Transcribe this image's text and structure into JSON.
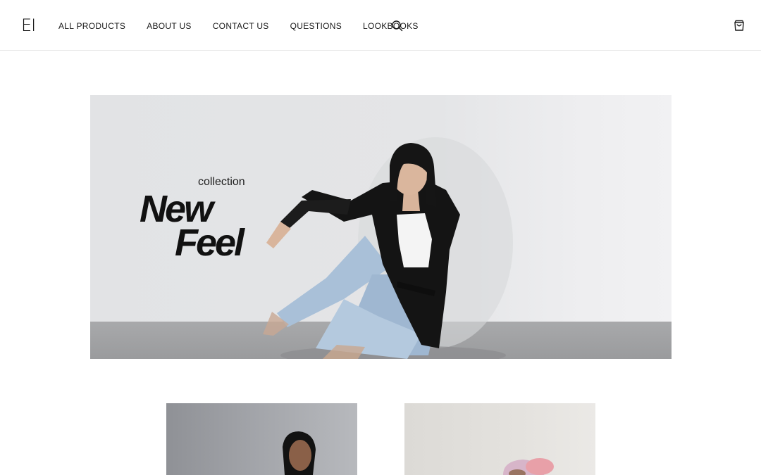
{
  "header": {
    "logo": "EI",
    "nav": [
      {
        "label": "ALL PRODUCTS"
      },
      {
        "label": "ABOUT US"
      },
      {
        "label": "CONTACT US"
      },
      {
        "label": "QUESTIONS"
      },
      {
        "label": "LOOKBOOKS"
      }
    ],
    "search_icon": "search-icon",
    "cart_icon": "shopping-bag-icon"
  },
  "hero": {
    "eyebrow": "collection",
    "title_line1": "New",
    "title_line2": "Feel"
  },
  "colors": {
    "text": "#111111",
    "background": "#ffffff",
    "hero_wall": "#e3e4e6",
    "hero_floor": "#9f a0a2"
  }
}
